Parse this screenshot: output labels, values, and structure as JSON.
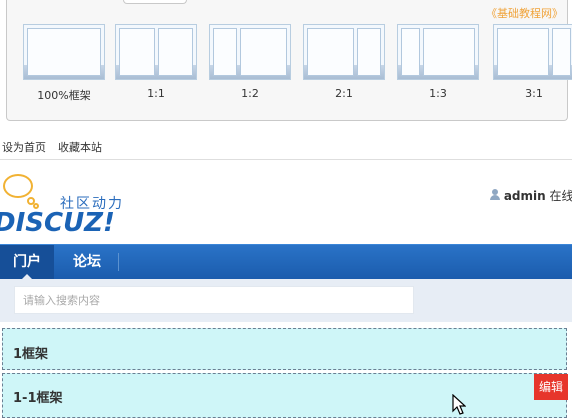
{
  "picker": {
    "site_credit": "《基础教程网》",
    "layouts": [
      {
        "label": "100%框架",
        "panes": [
          1
        ]
      },
      {
        "label": "1:1",
        "panes": [
          1,
          1
        ]
      },
      {
        "label": "1:2",
        "panes": [
          1,
          2
        ]
      },
      {
        "label": "2:1",
        "panes": [
          2,
          1
        ]
      },
      {
        "label": "1:3",
        "panes": [
          1,
          3
        ]
      },
      {
        "label": "3:1",
        "panes": [
          3,
          1
        ]
      }
    ]
  },
  "topbar": {
    "set_home": "设为首页",
    "bookmark": "收藏本站"
  },
  "header": {
    "slogan": "社区动力",
    "logo_word": "DISCUZ!",
    "username": "admin",
    "status": "在线"
  },
  "nav": {
    "tabs": [
      "门户",
      "论坛"
    ],
    "active": 0
  },
  "search": {
    "placeholder": "请输入搜索内容",
    "value": ""
  },
  "frames": [
    {
      "title": "1框架"
    },
    {
      "title": "1-1框架"
    }
  ],
  "edit_label": "编辑",
  "colors": {
    "nav_blue": "#1b5cad",
    "frame_fill": "#cff6f8",
    "edit_red": "#e7352b",
    "credit_orange": "#f0a33a"
  }
}
